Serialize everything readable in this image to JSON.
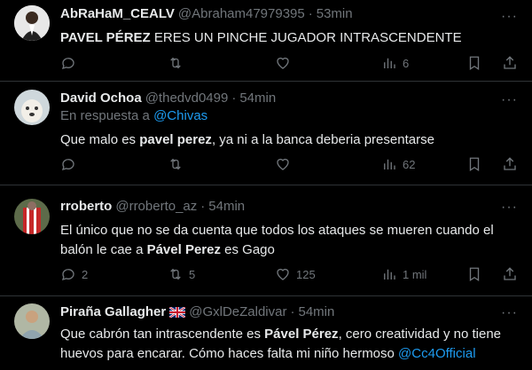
{
  "tweets": [
    {
      "name": "AbRaHaM_CEALV",
      "handle": "@Abraham47979395",
      "time": "53min",
      "text_bold": "PAVEL PÉREZ",
      "text_rest": " ERES UN PINCHE JUGADOR INTRASCENDENTE",
      "replies": "",
      "retweets": "",
      "likes": "",
      "views": "6"
    },
    {
      "name": "David Ochoa",
      "handle": "@thedvd0499",
      "time": "54min",
      "reply_prefix": "En respuesta a",
      "reply_to": "@Chivas",
      "text_a": "Que malo es ",
      "text_bold": "pavel perez",
      "text_b": ", ya ni a la banca deberia presentarse",
      "replies": "",
      "retweets": "",
      "likes": "",
      "views": "62"
    },
    {
      "name": "rroberto",
      "handle": "@rroberto_az",
      "time": "54min",
      "text_line1": "El único que no se da cuenta que todos los ataques se mueren cuando el",
      "text_a": "balón le cae a ",
      "text_bold": "Pável Perez",
      "text_b": " es Gago",
      "replies": "2",
      "retweets": "5",
      "likes": "125",
      "views": "1 mil"
    },
    {
      "name": "Piraña Gallagher",
      "handle": "@GxlDeZaldivar",
      "time": "54min",
      "text_a": "Que cabrón tan intrascendente es ",
      "text_bold": "Pável Pérez",
      "text_b": ", cero creatividad y no tiene",
      "text_line2": "huevos para encarar. Cómo haces falta mi niño hermoso ",
      "mention": "@Cc4Official"
    }
  ],
  "separator": "·",
  "more_glyph": "···",
  "colors": {
    "background": "#000000",
    "text": "#e7e9ea",
    "muted": "#71767b",
    "link": "#1d9bf0",
    "border": "#2f3336"
  }
}
